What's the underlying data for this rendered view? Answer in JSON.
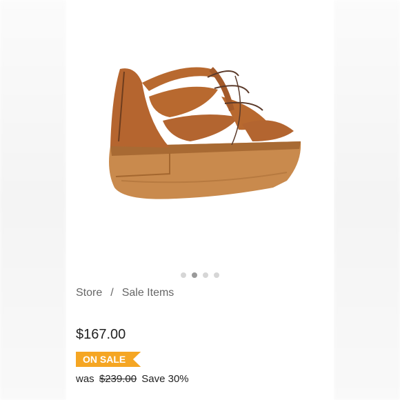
{
  "product": {
    "image_alt": "Brown leather lace-up platform sandal",
    "carousel": {
      "count": 4,
      "active_index": 1
    }
  },
  "breadcrumb": {
    "items": [
      "Store",
      "Sale Items"
    ],
    "separator": "/"
  },
  "pricing": {
    "current": "$167.00",
    "badge": "ON SALE",
    "was_label": "was",
    "original": "$239.00",
    "savings": "Save 30%"
  },
  "colors": {
    "badge": "#f5a623",
    "leather": "#b5652f",
    "sole": "#c98a4d"
  }
}
